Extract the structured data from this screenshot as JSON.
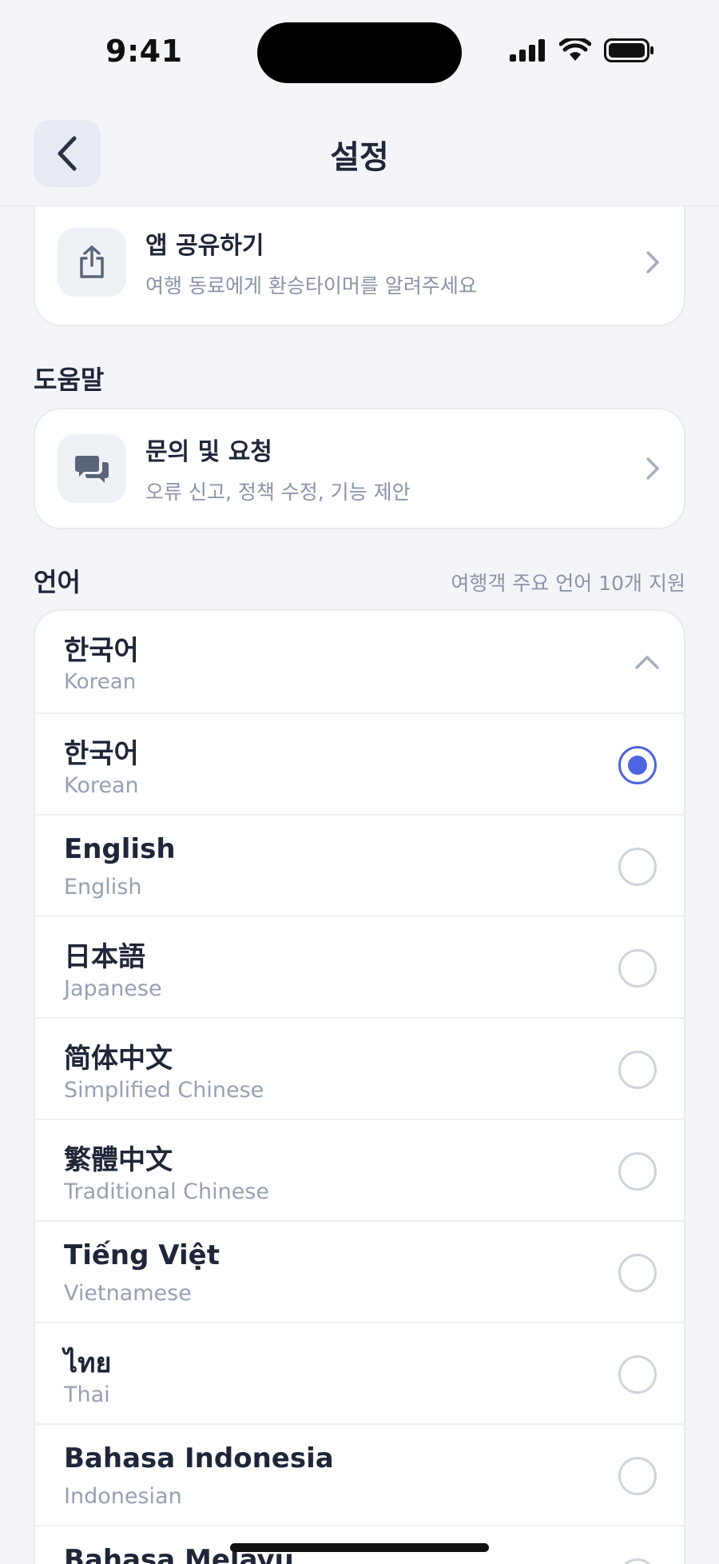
{
  "status": {
    "time": "9:41"
  },
  "nav": {
    "title": "설정"
  },
  "share": {
    "title": "앱 공유하기",
    "subtitle": "여행 동료에게 환승타이머를 알려주세요"
  },
  "help": {
    "section": "도움말",
    "item": {
      "title": "문의 및 요청",
      "subtitle": "오류 신고, 정책 수정, 기능 제안"
    }
  },
  "language": {
    "section": "언어",
    "note": "여행객 주요 언어 10개 지원",
    "current": {
      "name": "한국어",
      "sub": "Korean"
    },
    "options": [
      {
        "name": "한국어",
        "sub": "Korean",
        "selected": true
      },
      {
        "name": "English",
        "sub": "English",
        "selected": false
      },
      {
        "name": "日本語",
        "sub": "Japanese",
        "selected": false
      },
      {
        "name": "简体中文",
        "sub": "Simplified Chinese",
        "selected": false
      },
      {
        "name": "繁體中文",
        "sub": "Traditional Chinese",
        "selected": false
      },
      {
        "name": "Tiếng Việt",
        "sub": "Vietnamese",
        "selected": false
      },
      {
        "name": "ไทย",
        "sub": "Thai",
        "selected": false
      },
      {
        "name": "Bahasa Indonesia",
        "sub": "Indonesian",
        "selected": false
      },
      {
        "name": "Bahasa Melayu",
        "sub": "",
        "selected": false
      }
    ]
  },
  "colors": {
    "accent": "#4f64e0",
    "background": "#f4f5f8",
    "text": "#1f2638",
    "muted": "#8a93a6"
  },
  "icons": [
    "back-chevron-icon",
    "share-icon",
    "chat-bubbles-icon",
    "chevron-right-icon",
    "chevron-up-icon"
  ]
}
